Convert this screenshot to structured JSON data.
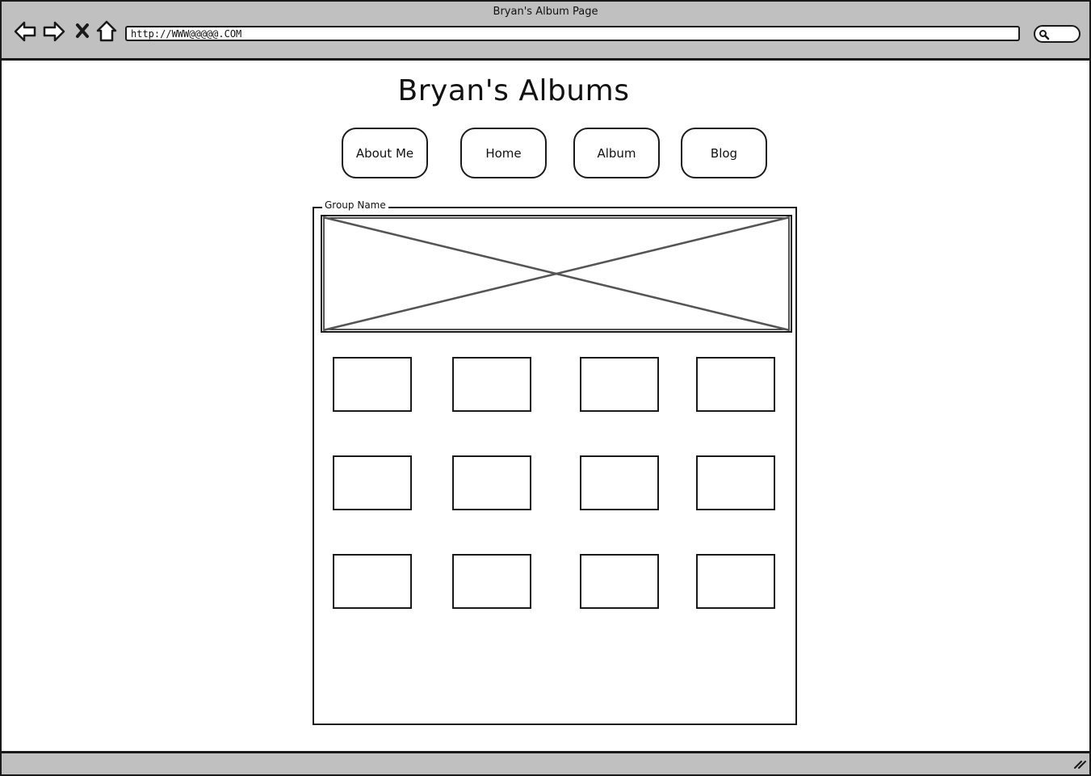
{
  "browser": {
    "window_title": "Bryan's Album Page",
    "url": "http://WWW@@@@@.COM",
    "icons": [
      "back-arrow-icon",
      "forward-arrow-icon",
      "stop-icon",
      "home-icon",
      "search-icon",
      "resize-grip-icon"
    ]
  },
  "page": {
    "title": "Bryan's Albums"
  },
  "nav": {
    "about_label": "About Me",
    "home_label": "Home",
    "album_label": "Album",
    "blog_label": "Blog"
  },
  "group": {
    "label": "Group Name",
    "thumbnail_rows": 3,
    "thumbnail_columns": 4
  }
}
